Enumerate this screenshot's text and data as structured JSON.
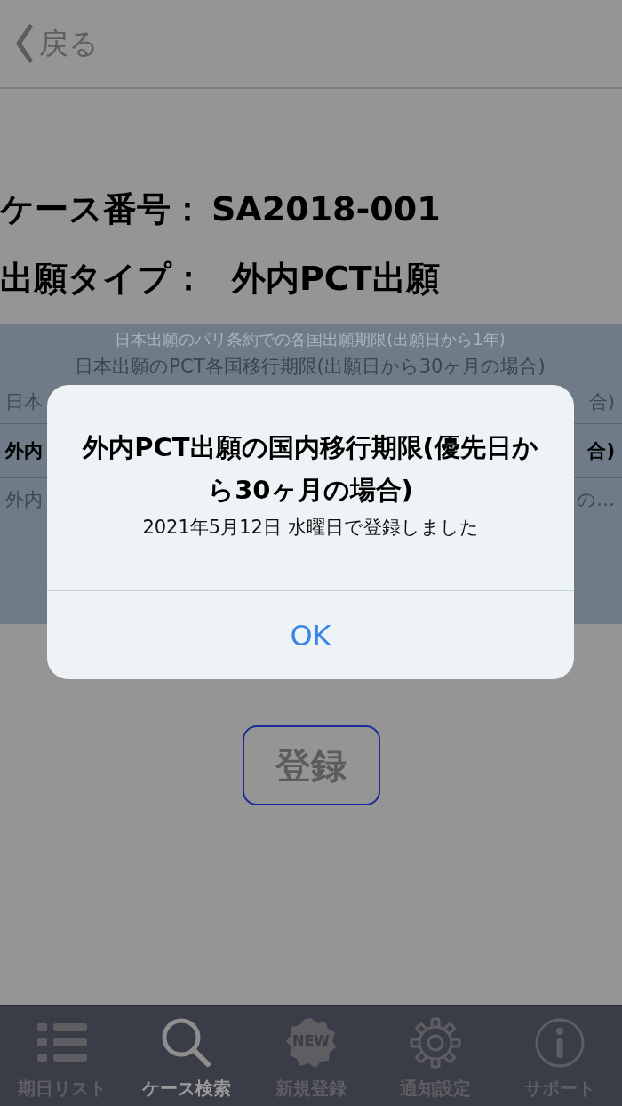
{
  "nav": {
    "back_label": "戻る"
  },
  "case": {
    "number_label": "ケース番号：",
    "number": "SA2018-001",
    "type_label": "出願タイプ：",
    "type": "外内PCT出願"
  },
  "picker": {
    "rows": [
      {
        "left": "日本出願のパリ条約での各国出願期限(出願日から1年)",
        "selected": false
      },
      {
        "left": "日本出願のPCT各国移行期限(出願日から30ヶ月の場合)",
        "selected": false
      },
      {
        "left": "日本",
        "right": "合)",
        "selected": false
      },
      {
        "left": "外内",
        "right": "合)",
        "selected": true
      },
      {
        "left": "外内",
        "right": "の…",
        "selected": false
      }
    ]
  },
  "register_button": "登録",
  "alert": {
    "title": "外内PCT出願の国内移行期限(優先日から30ヶ月の場合)",
    "message": "2021年5月12日 水曜日で登録しました",
    "button": "OK"
  },
  "tab_bar": [
    {
      "kind": "list",
      "label": "期日リスト",
      "selected": false
    },
    {
      "kind": "search",
      "label": "ケース検索",
      "selected": true
    },
    {
      "kind": "new",
      "badge_text": "NEW",
      "label": "新規登録",
      "selected": false
    },
    {
      "kind": "gear",
      "label": "通知設定",
      "selected": false
    },
    {
      "kind": "info",
      "label": "サポート",
      "selected": false
    }
  ]
}
